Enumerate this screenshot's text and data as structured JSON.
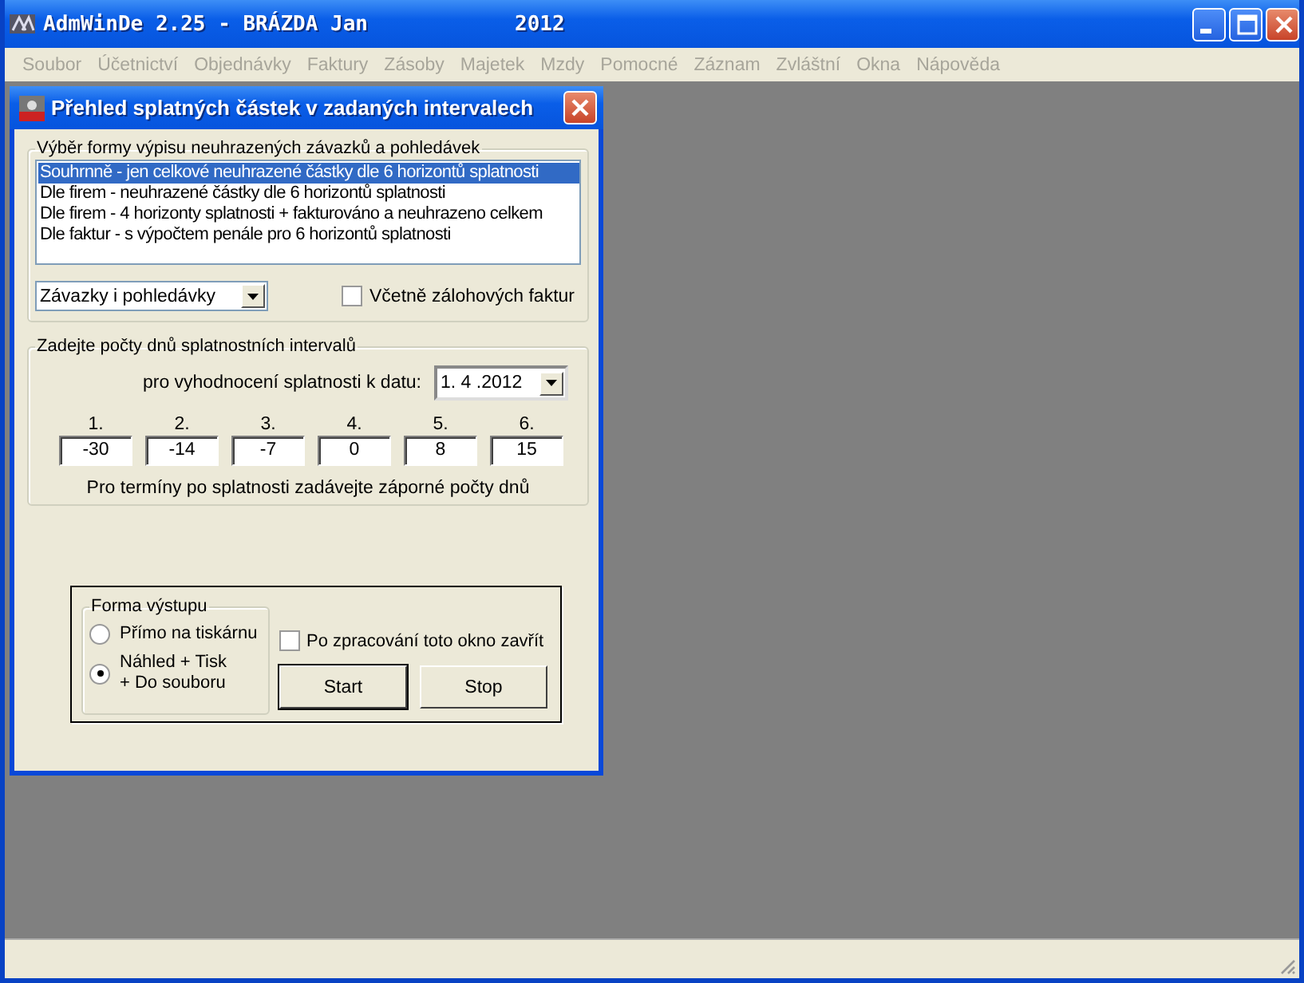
{
  "window": {
    "title": "AdmWinDe 2.25 - BRÁZDA Jan",
    "year": "2012"
  },
  "menu": [
    {
      "label": "Soubor",
      "disabled": true
    },
    {
      "label": "Účetnictví",
      "disabled": true
    },
    {
      "label": "Objednávky",
      "disabled": true
    },
    {
      "label": "Faktury",
      "disabled": true
    },
    {
      "label": "Zásoby",
      "disabled": true
    },
    {
      "label": "Majetek",
      "disabled": true
    },
    {
      "label": "Mzdy",
      "disabled": true
    },
    {
      "label": "Pomocné",
      "disabled": true
    },
    {
      "label": "Záznam",
      "disabled": true
    },
    {
      "label": "Zvláštní",
      "disabled": true
    },
    {
      "label": "Okna",
      "disabled": true
    },
    {
      "label": "Nápověda",
      "disabled": true
    }
  ],
  "dialog": {
    "title": "Přehled splatných částek v zadaných intervalech",
    "report_group": {
      "legend": "Výběr formy výpisu neuhrazených závazků a pohledávek",
      "options": [
        {
          "label": "Souhrnně - jen celkové neuhrazené částky dle 6 horizontů splatnosti",
          "selected": true
        },
        {
          "label": "Dle firem - neuhrazené částky dle 6 horizontů splatnosti",
          "selected": false
        },
        {
          "label": "Dle firem - 4 horizonty splatnosti + fakturováno a neuhrazeno celkem",
          "selected": false
        },
        {
          "label": "Dle faktur - s výpočtem penále pro 6 horizontů splatnosti",
          "selected": false
        }
      ],
      "type_combo": "Závazky i pohledávky",
      "include_advances": {
        "label": "Včetně zálohových faktur",
        "checked": false
      }
    },
    "interval_group": {
      "legend": "Zadejte počty dnů splatnostních intervalů",
      "date_label": "pro vyhodnocení splatnosti k datu:",
      "date": "1. 4 .2012",
      "intervals": [
        {
          "label": "1.",
          "value": "-30"
        },
        {
          "label": "2.",
          "value": "-14"
        },
        {
          "label": "3.",
          "value": "-7"
        },
        {
          "label": "4.",
          "value": "0"
        },
        {
          "label": "5.",
          "value": "8"
        },
        {
          "label": "6.",
          "value": "15"
        }
      ],
      "hint": "Pro termíny po splatnosti zadávejte záporné počty dnů"
    },
    "output_group": {
      "legend": "Forma výstupu",
      "options": [
        {
          "label": "Přímo na tiskárnu",
          "selected": false
        },
        {
          "label": "Náhled + Tisk\n+ Do souboru",
          "selected": true
        }
      ]
    },
    "close_after": {
      "label": "Po zpracování toto okno zavřít",
      "checked": false
    },
    "buttons": [
      "Start",
      "Stop"
    ]
  }
}
